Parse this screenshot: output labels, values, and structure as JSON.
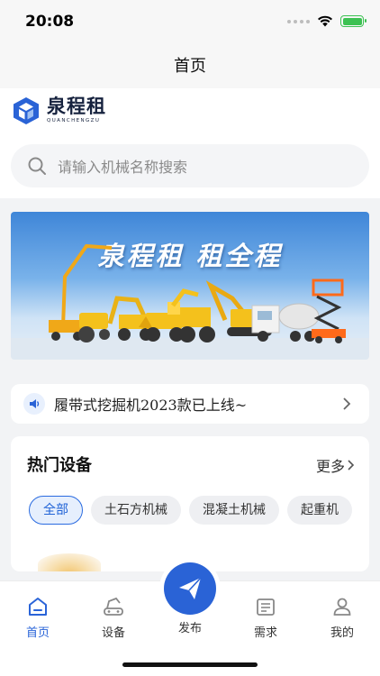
{
  "status_bar": {
    "time": "20:08"
  },
  "nav": {
    "title": "首页"
  },
  "brand": {
    "name_cn": "泉程租",
    "name_en": "QUANCHENGZU",
    "color": "#2a63d6"
  },
  "search": {
    "placeholder": "请输入机械名称搜索"
  },
  "banner": {
    "slogan": "泉程租 租全程"
  },
  "notice": {
    "text": "履带式挖掘机2023款已上线~"
  },
  "hot": {
    "title": "热门设备",
    "more": "更多",
    "chips": [
      {
        "label": "全部",
        "active": true
      },
      {
        "label": "土石方机械",
        "active": false
      },
      {
        "label": "混凝土机械",
        "active": false
      },
      {
        "label": "起重机",
        "active": false
      }
    ]
  },
  "tabs": [
    {
      "label": "首页",
      "icon": "home-icon",
      "active": true
    },
    {
      "label": "设备",
      "icon": "equipment-icon",
      "active": false
    },
    {
      "label": "发布",
      "icon": "paper-plane-icon",
      "active": false
    },
    {
      "label": "需求",
      "icon": "list-icon",
      "active": false
    },
    {
      "label": "我的",
      "icon": "person-icon",
      "active": false
    }
  ],
  "colors": {
    "accent": "#2a63d6",
    "battery": "#3cc152",
    "page_bg": "#f2f3f5"
  }
}
